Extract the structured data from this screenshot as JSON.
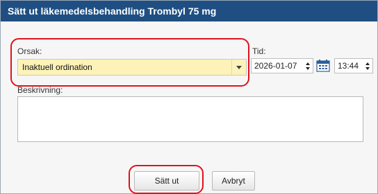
{
  "dialog": {
    "title": "Sätt ut läkemedelsbehandling Trombyl 75 mg"
  },
  "form": {
    "reason_label": "Orsak:",
    "reason_value": "Inaktuell ordination",
    "time_label": "Tid:",
    "date_value": "2026-01-07",
    "time_value": "13:44",
    "description_label": "Beskrivning:",
    "description_value": ""
  },
  "buttons": {
    "discontinue": "Sätt ut",
    "cancel": "Avbryt"
  },
  "icons": {
    "calendar": "calendar-icon",
    "dropdown": "chevron-down-icon",
    "spinner": "spinner-arrows-icon"
  },
  "colors": {
    "titlebar": "#1f4f82",
    "select_highlight": "#fdf3b8",
    "annotation": "#e0121b"
  }
}
